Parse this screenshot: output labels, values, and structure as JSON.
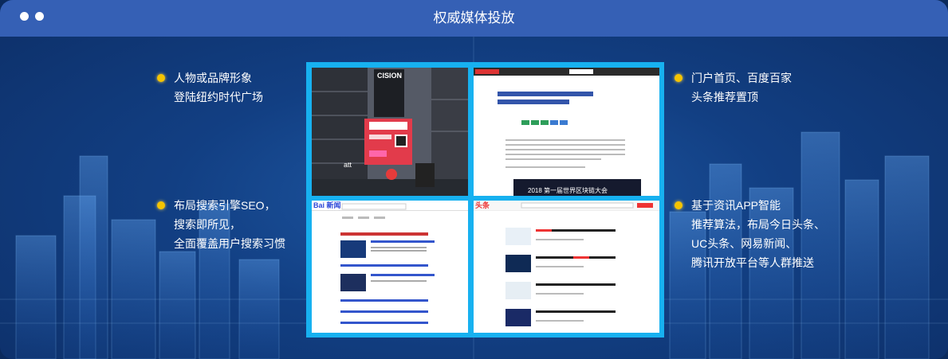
{
  "header": {
    "title": "权威媒体投放"
  },
  "features_left": [
    {
      "lines": [
        "人物或品牌形象",
        "登陆纽约时代广场"
      ]
    },
    {
      "lines": [
        "布局搜索引擎SEO，",
        "搜索即所见，",
        "全面覆盖用户搜索习惯"
      ]
    }
  ],
  "features_right": [
    {
      "lines": [
        "门户首页、百度百家",
        "头条推荐置顶"
      ]
    },
    {
      "lines": [
        "基于资讯APP智能",
        "推荐算法，布局今日头条、",
        "UC头条、网易新闻、",
        "腾讯开放平台等人群推送"
      ]
    }
  ],
  "screens": {
    "times_square": {
      "sign": "CISION",
      "billboard_brand": "att"
    },
    "portal_article": {
      "banner": "2018 第一届世界区块链大会"
    },
    "baidu_news": {
      "logo": "Bai 新闻"
    },
    "toutiao": {
      "logo": "头条"
    }
  },
  "colors": {
    "bullet": "#f5c400",
    "titlebar": "#3560b5",
    "collage_border": "#17b1f0"
  }
}
